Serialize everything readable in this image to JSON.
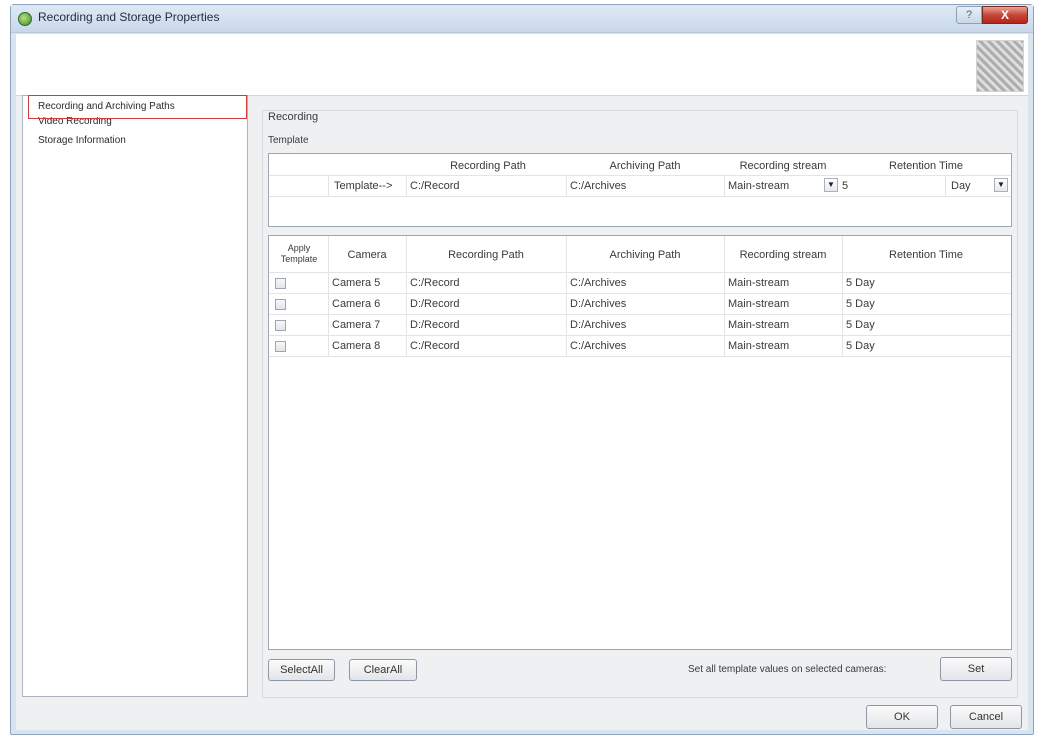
{
  "window": {
    "title": "Recording and Storage Properties",
    "help_label": "?",
    "close_label": "X"
  },
  "nav": {
    "items": [
      {
        "label": "Recording and Archiving Paths"
      },
      {
        "label": "Video Recording"
      },
      {
        "label": "Storage Information"
      }
    ]
  },
  "recording_label": "Recording",
  "template_label": "Template",
  "template_table": {
    "headers": [
      "Recording Path",
      "Archiving Path",
      "Recording stream",
      "Retention Time"
    ],
    "row": {
      "label": "Template-->",
      "recording_path": "C:/Record",
      "archiving_path": "C:/Archives",
      "recording_stream": "Main-stream",
      "retention_value": "5",
      "retention_unit": "Day"
    }
  },
  "camera_table": {
    "headers": {
      "apply_template": "Apply Template",
      "camera": "Camera",
      "recording_path": "Recording Path",
      "archiving_path": "Archiving Path",
      "recording_stream": "Recording stream",
      "retention_time": "Retention Time"
    },
    "rows": [
      {
        "camera": "Camera 5",
        "recording_path": "C:/Record",
        "archiving_path": "C:/Archives",
        "recording_stream": "Main-stream",
        "retention": "5 Day"
      },
      {
        "camera": "Camera 6",
        "recording_path": "D:/Record",
        "archiving_path": "D:/Archives",
        "recording_stream": "Main-stream",
        "retention": "5 Day"
      },
      {
        "camera": "Camera 7",
        "recording_path": "D:/Record",
        "archiving_path": "D:/Archives",
        "recording_stream": "Main-stream",
        "retention": "5 Day"
      },
      {
        "camera": "Camera 8",
        "recording_path": "C:/Record",
        "archiving_path": "C:/Archives",
        "recording_stream": "Main-stream",
        "retention": "5 Day"
      }
    ]
  },
  "buttons": {
    "select_all": "SelectAll",
    "clear_all": "ClearAll",
    "set_hint": "Set all template values on selected cameras:",
    "set": "Set",
    "ok": "OK",
    "cancel": "Cancel"
  }
}
